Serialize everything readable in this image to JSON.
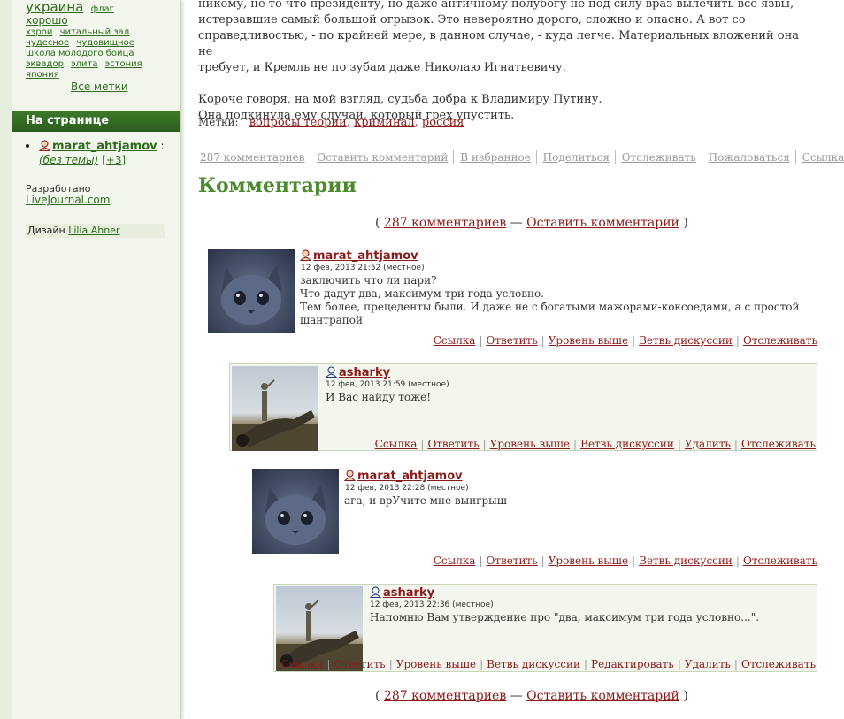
{
  "sidebar": {
    "tags": [
      {
        "label": "украина",
        "size": "big"
      },
      {
        "label": "флаг",
        "size": "small"
      },
      {
        "label": "хорошо",
        "size": "med"
      },
      {
        "label": "хэрои",
        "size": "small"
      },
      {
        "label": "читальный зал",
        "size": "small"
      },
      {
        "label": "чудесное",
        "size": "small"
      },
      {
        "label": "чудовищное",
        "size": "small"
      },
      {
        "label": "школа молодого бойца",
        "size": "small"
      },
      {
        "label": "эквадор",
        "size": "small"
      },
      {
        "label": "элита",
        "size": "small"
      },
      {
        "label": "эстония",
        "size": "small"
      },
      {
        "label": "япония",
        "size": "small"
      }
    ],
    "all_tags_label": "Все метки",
    "on_page_title": "На странице",
    "on_page_user": "marat_ahtjamov",
    "on_page_colon": ":",
    "on_page_subject": "(без темы)",
    "on_page_count": "[+3]",
    "developed_by": "Разработано",
    "livejournal": "LiveJournal.com",
    "design_label": "Дизайн",
    "design_author": "Lilia Ahner"
  },
  "post": {
    "line1": "никому, не то что президенту, но даже античному полубогу не под силу враз вылечить все язвы,",
    "line2": "истерзавшие самый большой огрызок. Это невероятно дорого, сложно и опасно. А вот со",
    "line3": "справедливостью, - по крайней мере, в данном случае, - куда легче. Материальных вложений она не",
    "line4": "требует, и Кремль не по зубам даже Николаю Игнатьевичу.",
    "line5": "Короче говоря, на мой взгляд, судьба добра к Владимиру Путину.",
    "line6": "Она подкинула ему случай, который грех упустить."
  },
  "tags_line": {
    "label": "Метки:",
    "tag1": "вопросы теории",
    "tag2": "криминал",
    "tag3": "россия"
  },
  "actions": {
    "comments_count": "287 комментариев",
    "leave_comment": "Оставить комментарий",
    "favorites": "В избранное",
    "share": "Поделиться",
    "track": "Отслеживать",
    "complain": "Пожаловаться",
    "link": "Ссылка"
  },
  "comments_heading": "Комментарии",
  "count_line": {
    "open": "(",
    "count": "287 комментариев",
    "dash": "—",
    "leave": "Оставить комментарий",
    "close": ")"
  },
  "comments": [
    {
      "user": "marat_ahtjamov",
      "date": "12 фев, 2013 21:52 (местное)",
      "text_lines": [
        "заключить что ли пари?",
        "Что дадут два, максимум три года условно.",
        "Тем более, прецеденты были. И даже не с богатыми мажорами-коксоедами, а с простой",
        "шантрапой"
      ],
      "links": [
        "Ссылка",
        "Ответить",
        "Уровень выше",
        "Ветвь дискуссии",
        "Отслеживать"
      ]
    },
    {
      "user": "asharky",
      "date": "12 фев, 2013 21:59 (местное)",
      "text_lines": [
        "И Вас найду тоже!"
      ],
      "links": [
        "Ссылка",
        "Ответить",
        "Уровень выше",
        "Ветвь дискуссии",
        "Удалить",
        "Отслеживать"
      ]
    },
    {
      "user": "marat_ahtjamov",
      "date": "12 фев, 2013 22:28 (местное)",
      "text_lines": [
        "ага, и врУчите мне выигрыш"
      ],
      "links": [
        "Ссылка",
        "Ответить",
        "Уровень выше",
        "Ветвь дискуссии",
        "Отслеживать"
      ]
    },
    {
      "user": "asharky",
      "date": "12 фев, 2013 22:36 (местное)",
      "text_lines": [
        "Напомню Вам утверждение про \"два, максимум три года условно...\"."
      ],
      "links": [
        "Ссылка",
        "Ответить",
        "Уровень выше",
        "Ветвь дискуссии",
        "Редактировать",
        "Удалить",
        "Отслеживать"
      ]
    }
  ]
}
